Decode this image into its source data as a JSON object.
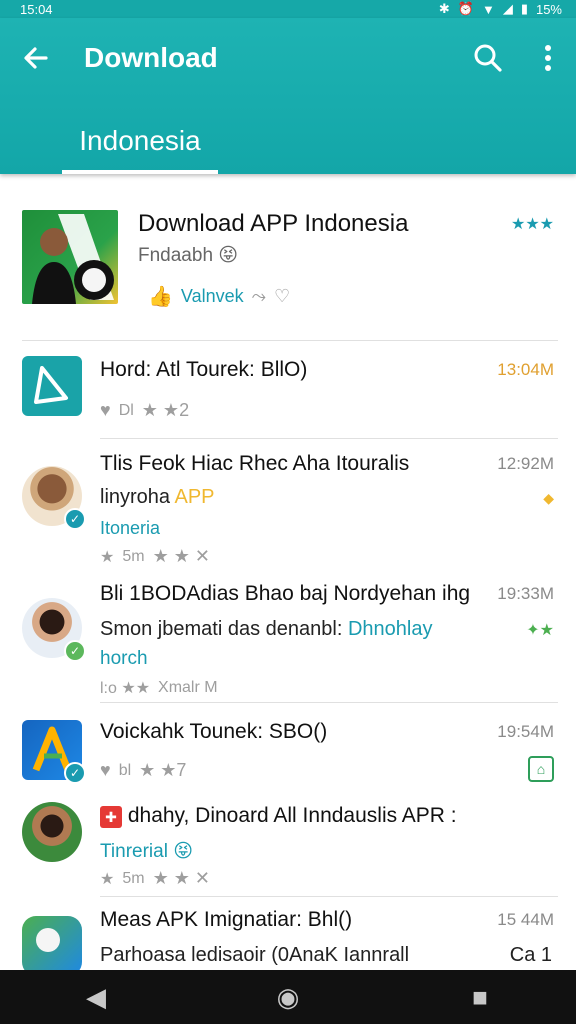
{
  "status_bar": {
    "time": "15:04",
    "battery": "15%"
  },
  "app_bar": {
    "title": "Download",
    "tab": "Indonesia"
  },
  "featured": {
    "title": "Download APP Indonesia",
    "subtitle": "Fndaabh 😝",
    "action_label": "Valnvek",
    "rating_stars": "★★★"
  },
  "items": [
    {
      "title": "Hord: Atl Tourek: BllO)",
      "size": "13:04M",
      "meta_left": "Dl",
      "meta_right": "★ ★2"
    },
    {
      "title": "Tlis Feok Hiac Rhec Aha Itouralis",
      "line2": "linyroha",
      "line2_tag": "APP",
      "line3": "Itoneria",
      "size": "12:92M",
      "meta_left": "5m",
      "meta_right": "★ ★ ✕"
    },
    {
      "title": "Bli 1BODAdias Bhao baj Nordyehan ihg",
      "line2": "Smon jbemati das denanbl:",
      "line2_tag": "Dhnohlay",
      "line3": "horch",
      "size": "19:33M",
      "meta_left": "l:o ★★",
      "meta_right": "Xmalr M"
    },
    {
      "title": "Voickahk Tounek: SBO()",
      "size": "19:54M",
      "meta_left": "bl",
      "meta_right": "★ ★7"
    },
    {
      "title": "dhahy, Dinoard All Inndauslis APR :",
      "line2": "Tinrerial",
      "size": "",
      "meta_left": "5m",
      "meta_right": "★ ★ ✕"
    },
    {
      "title": "Meas APK Imignatiar: Bhl()",
      "line2": "Parhoasa   ledisaoir (0AnaK Iannrall",
      "size": "15 44M",
      "extra": "Ca 1"
    }
  ],
  "colors": {
    "accent": "#16a8a8",
    "size_orange": "#e0a030",
    "teal_text": "#1a9bb0"
  }
}
